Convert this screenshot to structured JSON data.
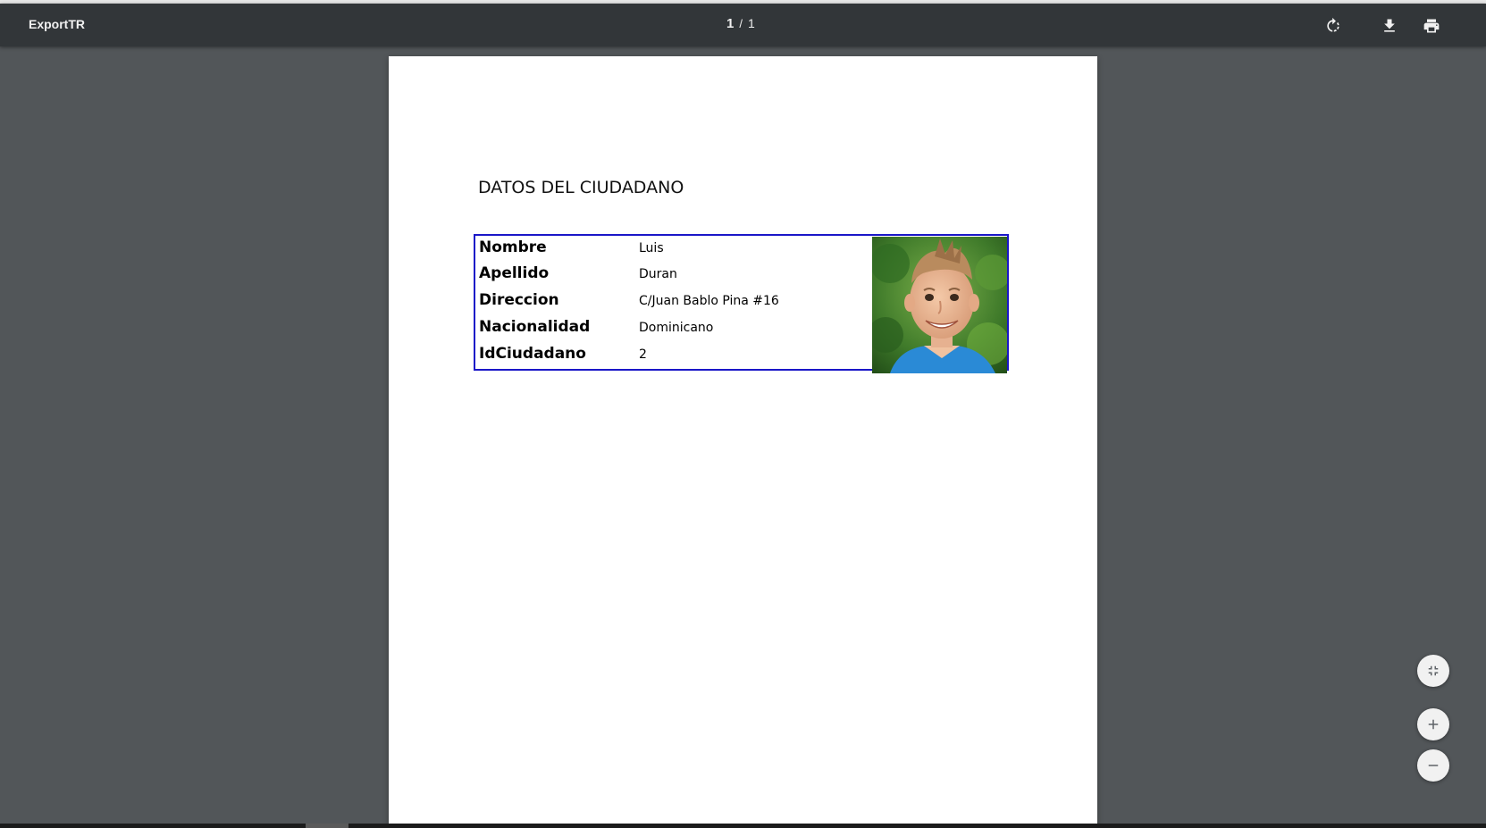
{
  "viewer": {
    "title": "ExportTR",
    "current_page": "1",
    "separator": "/",
    "total_pages": "1",
    "actions": [
      {
        "name": "rotate-icon"
      },
      {
        "name": "download-icon"
      },
      {
        "name": "print-icon"
      }
    ],
    "zoom_controls": [
      {
        "name": "fit-to-page-icon"
      },
      {
        "name": "zoom-in-icon"
      },
      {
        "name": "zoom-out-icon"
      }
    ]
  },
  "document": {
    "heading": "DATOS DEL CIUDADANO",
    "border_color": "#1a16c8",
    "fields": [
      {
        "label": "Nombre",
        "value": "Luis"
      },
      {
        "label": "Apellido",
        "value": "Duran"
      },
      {
        "label": "Direccion",
        "value": "C/Juan Bablo Pina #16"
      },
      {
        "label": "Nacionalidad",
        "value": "Dominicano"
      },
      {
        "label": "IdCiudadano",
        "value": "2"
      }
    ]
  },
  "colors": {
    "toolbar": "#323639",
    "viewer_background": "#525659",
    "page": "#ffffff"
  }
}
